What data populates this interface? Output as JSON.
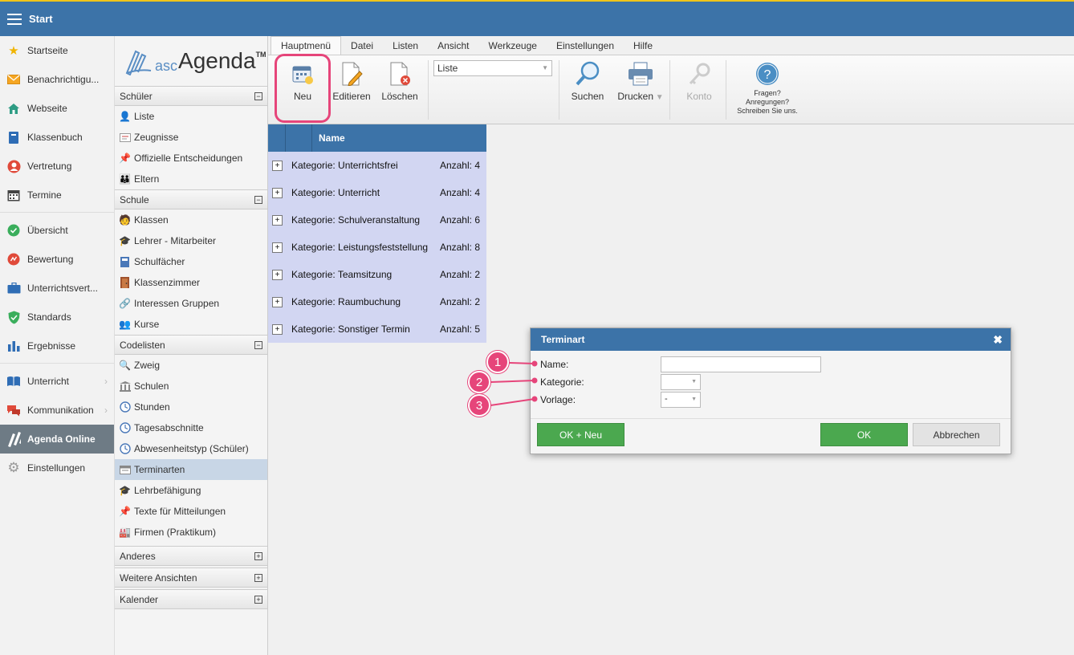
{
  "topbar": {
    "title": "Start"
  },
  "leftnav": {
    "group1": [
      {
        "label": "Startseite",
        "icon": "star-icon"
      },
      {
        "label": "Benachrichtigu...",
        "icon": "envelope-icon"
      },
      {
        "label": "Webseite",
        "icon": "home-icon"
      },
      {
        "label": "Klassenbuch",
        "icon": "book-icon"
      },
      {
        "label": "Vertretung",
        "icon": "person-swap-icon"
      },
      {
        "label": "Termine",
        "icon": "calendar-icon"
      }
    ],
    "group2": [
      {
        "label": "Übersicht",
        "icon": "check-circle-icon"
      },
      {
        "label": "Bewertung",
        "icon": "rating-icon"
      },
      {
        "label": "Unterrichtsvert...",
        "icon": "briefcase-icon"
      },
      {
        "label": "Standards",
        "icon": "shield-check-icon"
      },
      {
        "label": "Ergebnisse",
        "icon": "bar-chart-icon"
      }
    ],
    "group3": [
      {
        "label": "Unterricht",
        "icon": "open-book-icon"
      },
      {
        "label": "Kommunikation",
        "icon": "chat-icon"
      },
      {
        "label": "Agenda Online",
        "icon": "agenda-pen-icon"
      },
      {
        "label": "Einstellungen",
        "icon": "gear-icon"
      }
    ]
  },
  "logo": {
    "prefix": "asc",
    "name": "Agenda",
    "tm": "TM"
  },
  "sidebar2": {
    "schueler": {
      "title": "Schüler",
      "items": [
        "Liste",
        "Zeugnisse",
        "Offizielle Entscheidungen",
        "Eltern"
      ]
    },
    "schule": {
      "title": "Schule",
      "items": [
        "Klassen",
        "Lehrer - Mitarbeiter",
        "Schulfächer",
        "Klassenzimmer",
        "Interessen Gruppen",
        "Kurse"
      ]
    },
    "codelisten": {
      "title": "Codelisten",
      "items": [
        "Zweig",
        "Schulen",
        "Stunden",
        "Tagesabschnitte",
        "Abwesenheitstyp (Schüler)",
        "Terminarten",
        "Lehrbefähigung",
        "Texte für Mitteilungen",
        "Firmen (Praktikum)"
      ]
    },
    "anderes": {
      "title": "Anderes"
    },
    "weitere": {
      "title": "Weitere Ansichten"
    },
    "kalender": {
      "title": "Kalender"
    }
  },
  "tabs": [
    "Hauptmenü",
    "Datei",
    "Listen",
    "Ansicht",
    "Werkzeuge",
    "Einstellungen",
    "Hilfe"
  ],
  "toolbar": {
    "neu": "Neu",
    "editieren": "Editieren",
    "loeschen": "Löschen",
    "view_select": "Liste",
    "suchen": "Suchen",
    "drucken": "Drucken",
    "konto": "Konto",
    "help_line1": "Fragen?",
    "help_line2": "Anregungen?",
    "help_line3": "Schreiben Sie uns."
  },
  "grid": {
    "header": "Name",
    "rows": [
      {
        "name": "Kategorie: Unterrichtsfrei",
        "count": "Anzahl: 4"
      },
      {
        "name": "Kategorie: Unterricht",
        "count": "Anzahl: 4"
      },
      {
        "name": "Kategorie: Schulveranstaltung",
        "count": "Anzahl: 6"
      },
      {
        "name": "Kategorie: Leistungsfeststellung",
        "count": "Anzahl: 8"
      },
      {
        "name": "Kategorie: Teamsitzung",
        "count": "Anzahl: 2"
      },
      {
        "name": "Kategorie: Raumbuchung",
        "count": "Anzahl: 2"
      },
      {
        "name": "Kategorie: Sonstiger Termin",
        "count": "Anzahl: 5"
      }
    ]
  },
  "dialog": {
    "title": "Terminart",
    "name_label": "Name:",
    "name_value": "",
    "kategorie_label": "Kategorie:",
    "kategorie_value": "",
    "vorlage_label": "Vorlage:",
    "vorlage_value": "-",
    "ok_neu": "OK + Neu",
    "ok": "OK",
    "abbrechen": "Abbrechen"
  },
  "callouts": [
    "1",
    "2",
    "3"
  ],
  "colors": {
    "header_blue": "#3c73a8",
    "highlight_pink": "#e6457a",
    "ok_green": "#4ba84f",
    "row_lilac": "#d2d6f2"
  }
}
